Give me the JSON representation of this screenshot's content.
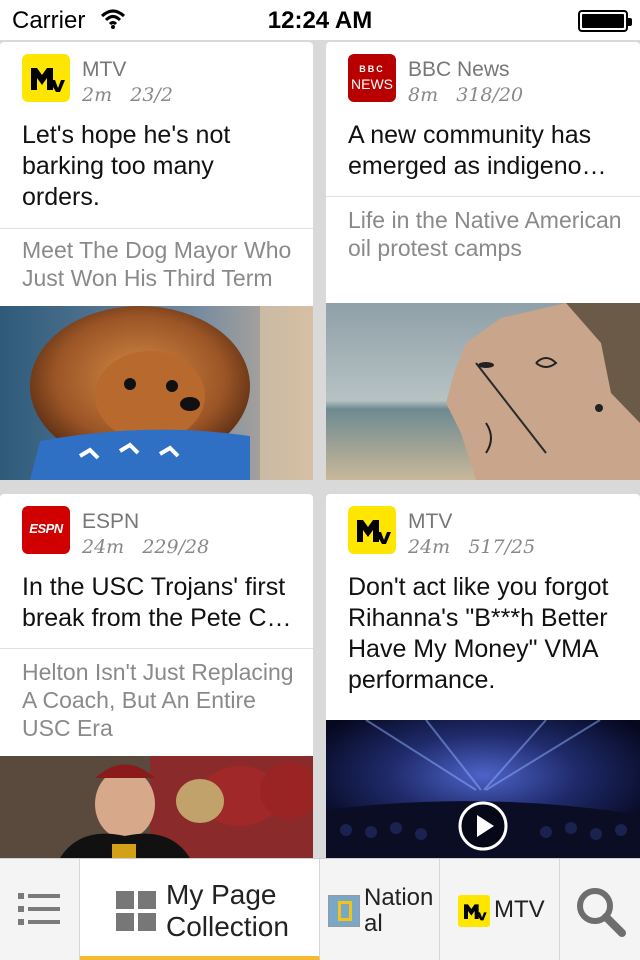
{
  "status_bar": {
    "carrier": "Carrier",
    "time": "12:24 AM"
  },
  "cards": [
    {
      "logo": "mtv-logo",
      "source": "MTV",
      "time_ago": "2m",
      "stats": "23/2",
      "headline": "Let's hope he's not barking too many orders.",
      "subtitle": "Meet The Dog Mayor Who Just Won His Third Term"
    },
    {
      "logo": "bbc-news-logo",
      "logo_text_top": "BBC",
      "logo_text_bottom": "NEWS",
      "source": "BBC News",
      "time_ago": "8m",
      "stats": "318/20",
      "headline": "A new community has emerged as indigeno…",
      "subtitle": "Life in the Native American oil protest camps"
    },
    {
      "logo": "espn-logo",
      "logo_text": "ESPN",
      "source": "ESPN",
      "time_ago": "24m",
      "stats": "229/28",
      "headline": "In the USC Trojans' first break from the Pete C…",
      "subtitle": "Helton Isn't Just Replacing A Coach, But An Entire USC Era"
    },
    {
      "logo": "mtv-logo",
      "source": "MTV",
      "time_ago": "24m",
      "stats": "517/25",
      "headline": "Don't act like you forgot Rihanna's \"B***h Better Have My Money\" VMA performance."
    }
  ],
  "bottom_bar": {
    "menu_icon": "list-icon",
    "active_tab": {
      "icon": "grid-icon",
      "line1": "My Page",
      "line2": "Collection"
    },
    "tab_national": {
      "line1": "Nation",
      "line2": "al"
    },
    "tab_mtv": "MTV",
    "search_icon": "search-icon"
  },
  "colors": {
    "accent": "#f5b82e",
    "mtv_yellow": "#ffe600",
    "bbc_red": "#b80000",
    "espn_red": "#d00000"
  }
}
